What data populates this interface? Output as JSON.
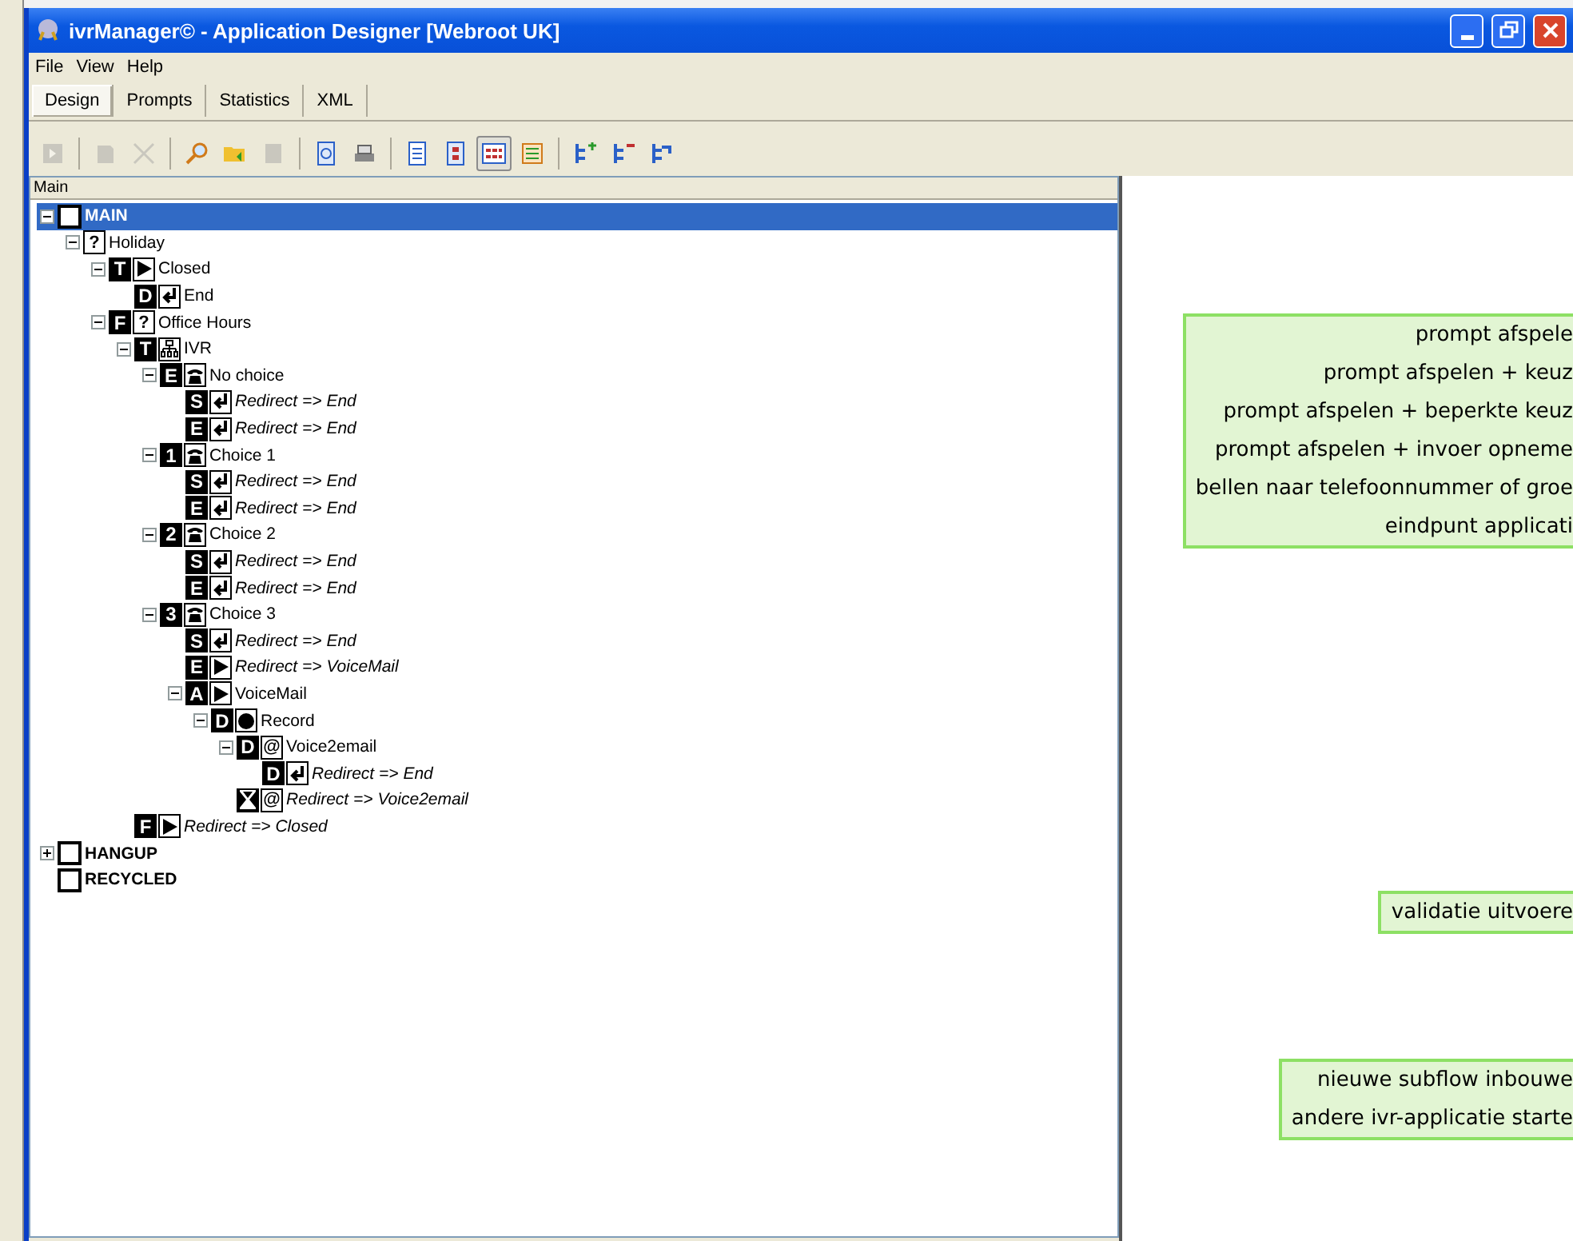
{
  "window": {
    "title": "ivrManager© - Application Designer [Webroot UK]"
  },
  "menu": [
    "File",
    "View",
    "Help"
  ],
  "tabs": [
    {
      "label": "Design",
      "selected": true
    },
    {
      "label": "Prompts",
      "selected": false
    },
    {
      "label": "Statistics",
      "selected": false
    },
    {
      "label": "XML",
      "selected": false
    }
  ],
  "toolbar": [
    {
      "kind": "doc-arrow",
      "disabled": true,
      "pressed": false
    },
    {
      "kind": "separator"
    },
    {
      "kind": "doc",
      "disabled": true,
      "pressed": false
    },
    {
      "kind": "delete",
      "disabled": true,
      "pressed": false
    },
    {
      "kind": "separator"
    },
    {
      "kind": "search",
      "disabled": false,
      "pressed": false
    },
    {
      "kind": "folder",
      "disabled": false,
      "pressed": false
    },
    {
      "kind": "block",
      "disabled": true,
      "pressed": false
    },
    {
      "kind": "separator"
    },
    {
      "kind": "preview",
      "disabled": false,
      "pressed": false
    },
    {
      "kind": "print",
      "disabled": false,
      "pressed": false
    },
    {
      "kind": "separator"
    },
    {
      "kind": "page",
      "disabled": false,
      "pressed": false
    },
    {
      "kind": "page-red",
      "disabled": false,
      "pressed": false
    },
    {
      "kind": "grid",
      "disabled": false,
      "pressed": true
    },
    {
      "kind": "list",
      "disabled": false,
      "pressed": false
    },
    {
      "kind": "separator"
    },
    {
      "kind": "tree-add",
      "disabled": false,
      "pressed": false
    },
    {
      "kind": "tree-remove",
      "disabled": false,
      "pressed": false
    },
    {
      "kind": "tree",
      "disabled": false,
      "pressed": false
    }
  ],
  "tree_title": "Main",
  "tree": [
    {
      "label": "MAIN",
      "kind": "square",
      "redirect": false,
      "selected": true,
      "expanded": true,
      "children": [
        {
          "label": "Holiday",
          "kind": "question",
          "symbol": "?",
          "redirect": false,
          "selected": false,
          "expanded": true,
          "children": [
            {
              "label": "Closed",
              "kind": "play",
              "badge": {
                "kind": "letter",
                "text": "T"
              },
              "redirect": false,
              "selected": false,
              "expanded": true,
              "children": [
                {
                  "label": "End",
                  "kind": "return",
                  "badge": {
                    "kind": "letter",
                    "text": "D"
                  },
                  "redirect": false,
                  "selected": false
                }
              ]
            },
            {
              "label": "Office Hours",
              "kind": "question",
              "symbol": "?",
              "badge": {
                "kind": "letter",
                "text": "F"
              },
              "redirect": false,
              "selected": false,
              "expanded": true,
              "children": [
                {
                  "label": "IVR",
                  "kind": "network",
                  "badge": {
                    "kind": "letter",
                    "text": "T"
                  },
                  "redirect": false,
                  "selected": false,
                  "expanded": true,
                  "children": [
                    {
                      "label": "No choice",
                      "kind": "phone",
                      "badge": {
                        "kind": "letter",
                        "text": "E"
                      },
                      "redirect": false,
                      "selected": false,
                      "expanded": true,
                      "children": [
                        {
                          "label": "Redirect => End",
                          "kind": "return",
                          "badge": {
                            "kind": "letter",
                            "text": "S"
                          },
                          "redirect": true,
                          "selected": false
                        },
                        {
                          "label": "Redirect => End",
                          "kind": "return",
                          "badge": {
                            "kind": "letter",
                            "text": "E"
                          },
                          "redirect": true,
                          "selected": false
                        }
                      ]
                    },
                    {
                      "label": "Choice 1",
                      "kind": "phone",
                      "badge": {
                        "kind": "letter",
                        "text": "1"
                      },
                      "redirect": false,
                      "selected": false,
                      "expanded": true,
                      "children": [
                        {
                          "label": "Redirect => End",
                          "kind": "return",
                          "badge": {
                            "kind": "letter",
                            "text": "S"
                          },
                          "redirect": true,
                          "selected": false
                        },
                        {
                          "label": "Redirect => End",
                          "kind": "return",
                          "badge": {
                            "kind": "letter",
                            "text": "E"
                          },
                          "redirect": true,
                          "selected": false
                        }
                      ]
                    },
                    {
                      "label": "Choice 2",
                      "kind": "phone",
                      "badge": {
                        "kind": "letter",
                        "text": "2"
                      },
                      "redirect": false,
                      "selected": false,
                      "expanded": true,
                      "children": [
                        {
                          "label": "Redirect => End",
                          "kind": "return",
                          "badge": {
                            "kind": "letter",
                            "text": "S"
                          },
                          "redirect": true,
                          "selected": false
                        },
                        {
                          "label": "Redirect => End",
                          "kind": "return",
                          "badge": {
                            "kind": "letter",
                            "text": "E"
                          },
                          "redirect": true,
                          "selected": false
                        }
                      ]
                    },
                    {
                      "label": "Choice 3",
                      "kind": "phone",
                      "badge": {
                        "kind": "letter",
                        "text": "3"
                      },
                      "redirect": false,
                      "selected": false,
                      "expanded": true,
                      "children": [
                        {
                          "label": "Redirect => End",
                          "kind": "return",
                          "badge": {
                            "kind": "letter",
                            "text": "S"
                          },
                          "redirect": true,
                          "selected": false
                        },
                        {
                          "label": "Redirect => VoiceMail",
                          "kind": "play",
                          "badge": {
                            "kind": "letter",
                            "text": "E"
                          },
                          "redirect": true,
                          "selected": false
                        },
                        {
                          "label": "VoiceMail",
                          "kind": "play",
                          "badge": {
                            "kind": "letter",
                            "text": "A"
                          },
                          "redirect": false,
                          "selected": false,
                          "expanded": true,
                          "children": [
                            {
                              "label": "Record",
                              "kind": "record",
                              "badge": {
                                "kind": "letter",
                                "text": "D"
                              },
                              "redirect": false,
                              "selected": false,
                              "expanded": true,
                              "children": [
                                {
                                  "label": "Voice2email",
                                  "kind": "at",
                                  "symbol": "@",
                                  "badge": {
                                    "kind": "letter",
                                    "text": "D"
                                  },
                                  "redirect": false,
                                  "selected": false,
                                  "expanded": true,
                                  "children": [
                                    {
                                      "label": "Redirect => End",
                                      "kind": "return",
                                      "badge": {
                                        "kind": "letter",
                                        "text": "D"
                                      },
                                      "redirect": true,
                                      "selected": false
                                    }
                                  ]
                                },
                                {
                                  "label": "Redirect => Voice2email",
                                  "kind": "at",
                                  "symbol": "@",
                                  "badge": {
                                    "kind": "hourglass"
                                  },
                                  "redirect": true,
                                  "selected": false
                                }
                              ]
                            }
                          ]
                        }
                      ]
                    }
                  ]
                },
                {
                  "label": "Redirect => Closed",
                  "kind": "play",
                  "badge": {
                    "kind": "letter",
                    "text": "F"
                  },
                  "redirect": true,
                  "selected": false
                }
              ]
            }
          ]
        }
      ]
    },
    {
      "label": "HANGUP",
      "kind": "square",
      "redirect": false,
      "selected": false,
      "expanded": false
    },
    {
      "label": "RECYCLED",
      "kind": "square",
      "redirect": false,
      "selected": false
    }
  ],
  "callouts": [
    {
      "lines": [
        "prompt afspele",
        "prompt afspelen + keuz",
        "prompt afspelen + beperkte keuz",
        "prompt afspelen + invoer opneme",
        "bellen naar telefoonnummer of groe",
        "eindpunt applicati"
      ]
    },
    {
      "lines": [
        "validatie uitvoere"
      ]
    },
    {
      "lines": [
        "nieuwe subflow inbouwe",
        "andere ivr-applicatie starte"
      ]
    }
  ]
}
